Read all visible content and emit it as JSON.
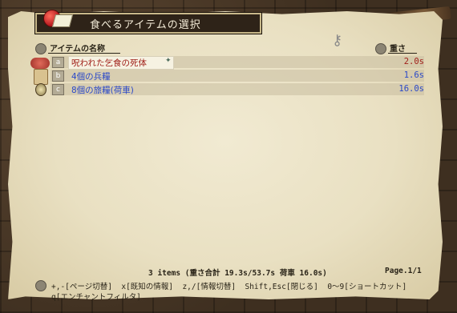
{
  "window": {
    "title": "食べるアイテムの選択"
  },
  "header": {
    "name_col": "アイテムの名称",
    "weight_col": "重さ"
  },
  "items": [
    {
      "key": "a",
      "name": "呪われた乞食の死体",
      "weight": "2.0s",
      "color": "#a0201a",
      "selected": true
    },
    {
      "key": "b",
      "name": "4個の兵糧",
      "weight": "1.6s",
      "color": "#2a48c8",
      "selected": false
    },
    {
      "key": "c",
      "name": "8個の旅糧(荷車)",
      "weight": "16.0s",
      "color": "#2a48c8",
      "selected": false
    }
  ],
  "footer": {
    "summary": "3 items  (重さ合計 19.3s/53.7s  荷車 16.0s)",
    "page": "Page.1/1"
  },
  "help": {
    "line1": "+,-[ページ切替]  x[既知の情報]  z,/[情報切替]  Shift,Esc[閉じる]  0～9[ショートカット]",
    "line2": "q[エンチャントフィルタ]"
  },
  "icons": {
    "title_icon": "apple-and-bread-icon",
    "header_bullet": "round-bullet-icon",
    "selected_arrow": "arrow-icon",
    "help_bullet": "round-bullet-icon"
  }
}
